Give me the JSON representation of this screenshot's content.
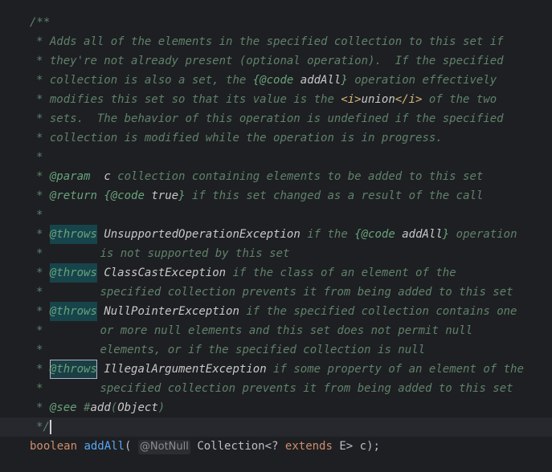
{
  "doc": {
    "open": "/**",
    "l1": "Adds all of the elements in the specified collection to this set if",
    "l2": "they're not already present (optional operation).  If the specified",
    "l3a": "collection is also a set, the ",
    "l3code": "{@code",
    "l3arg": "addAll",
    "l3close": "}",
    "l3b": " operation effectively",
    "l4a": "modifies this set so that its value is the ",
    "l4i": "<i>",
    "l4union": "union",
    "l4ic": "</i>",
    "l4b": " of the two",
    "l5": "sets.  The behavior of this operation is undefined if the specified",
    "l6": "collection is modified while the operation is in progress.",
    "param_tag": "@param",
    "param_name": "c",
    "param_desc": " collection containing elements to be added to this set",
    "return_tag": "@return",
    "return_code": "{@code",
    "return_val": "true",
    "return_close": "}",
    "return_desc": " if this set changed as a result of the call",
    "throws_tag": "@throws",
    "t1_ex": "UnsupportedOperationException",
    "t1_a": " if the ",
    "t1_code": "{@code",
    "t1_arg": "addAll",
    "t1_close": "}",
    "t1_b": " operation",
    "t1_c2": "is not supported by this set",
    "t2_ex": "ClassCastException",
    "t2_a": " if the class of an element of the",
    "t2_c2": "specified collection prevents it from being added to this set",
    "t3_ex": "NullPointerException",
    "t3_a": " if the specified collection contains one",
    "t3_c2": "or more null elements and this set does not permit null",
    "t3_c3": "elements, or if the specified collection is null",
    "t4_ex": "IllegalArgumentException",
    "t4_a": " if some property of an element of the",
    "t4_c2": "specified collection prevents it from being added to this set",
    "see_tag": "@see",
    "see_hash": "#",
    "see_method": "add",
    "see_paren_open": "(",
    "see_type": "Object",
    "see_paren_close": ")",
    "close": "*/",
    "star": "*"
  },
  "code": {
    "kw_boolean": "boolean",
    "method": "addAll",
    "paren_open": "(",
    "annotation": "@NotNull",
    "type": "Collection",
    "generic_open": "<? ",
    "kw_extends": "extends",
    "type_param": " E",
    "rest": "> c);"
  },
  "colors": {
    "background": "#1e1f22",
    "comment": "#5f826b",
    "doc_tag": "#67a37c",
    "keyword": "#cf8e6d",
    "method": "#56a8f5",
    "highlight": "#17444b"
  }
}
